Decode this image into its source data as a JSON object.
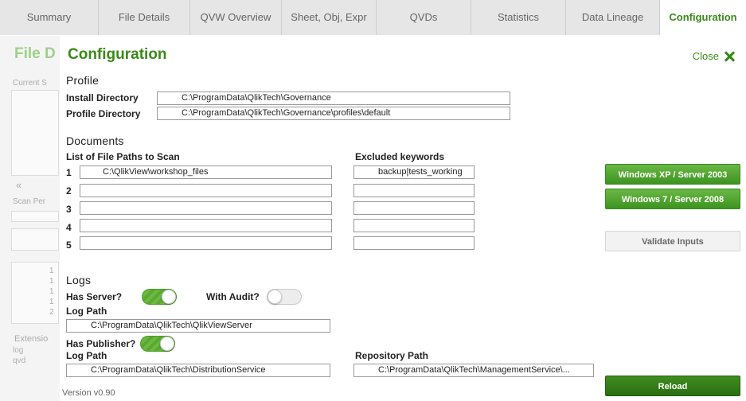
{
  "tabs": [
    "Summary",
    "File Details",
    "QVW Overview",
    "Sheet, Obj, Expr",
    "QVDs",
    "Statistics",
    "Data Lineage",
    "Configuration"
  ],
  "background": {
    "title": "File D",
    "current_label": "Current S",
    "arrow": "«",
    "scan_label": "Scan Per",
    "ext_label": "Extensio",
    "ext_items": [
      "log",
      "qvd"
    ],
    "num_items": [
      "1",
      "1",
      "1",
      "1",
      "2"
    ]
  },
  "panel": {
    "title": "Configuration",
    "close_label": "Close",
    "version": "Version v0.90"
  },
  "profile": {
    "heading": "Profile",
    "install_label": "Install Directory",
    "install_value": "C:\\ProgramData\\QlikTech\\Governance",
    "profile_label": "Profile Directory",
    "profile_value": "C:\\ProgramData\\QlikTech\\Governance\\profiles\\default"
  },
  "documents": {
    "heading": "Documents",
    "paths_label": "List of File Paths to Scan",
    "excluded_label": "Excluded keywords",
    "rows": [
      {
        "num": "1",
        "path": "C:\\QlikView\\workshop_files",
        "excluded": "backup|tests_working"
      },
      {
        "num": "2",
        "path": "",
        "excluded": ""
      },
      {
        "num": "3",
        "path": "",
        "excluded": ""
      },
      {
        "num": "4",
        "path": "",
        "excluded": ""
      },
      {
        "num": "5",
        "path": "",
        "excluded": ""
      }
    ]
  },
  "logs": {
    "heading": "Logs",
    "has_server_label": "Has Server?",
    "has_server": true,
    "with_audit_label": "With Audit?",
    "with_audit": false,
    "server_log_label": "Log Path",
    "server_log_value": "C:\\ProgramData\\QlikTech\\QlikViewServer",
    "has_publisher_label": "Has Publisher?",
    "has_publisher": true,
    "publisher_log_label": "Log Path",
    "publisher_log_value": "C:\\ProgramData\\QlikTech\\DistributionService",
    "repo_label": "Repository Path",
    "repo_value": "C:\\ProgramData\\QlikTech\\ManagementService\\..."
  },
  "buttons": {
    "winxp": "Windows XP / Server 2003",
    "win7": "Windows 7 / Server 2008",
    "validate": "Validate Inputs",
    "reload": "Reload"
  },
  "colors": {
    "accent": "#3a8a18",
    "button_green": "#4fa22c",
    "button_dark": "#2f7a16"
  }
}
